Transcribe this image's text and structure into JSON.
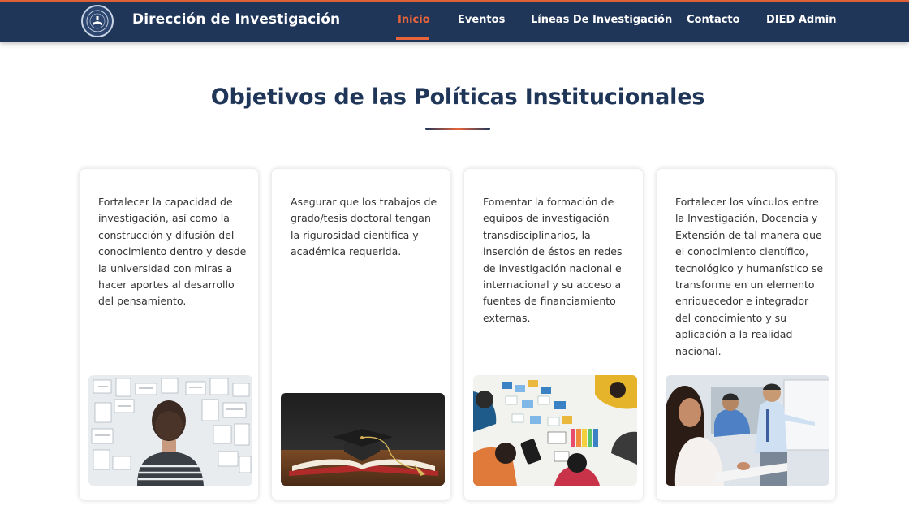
{
  "header": {
    "logo_icon": "university-seal-icon",
    "brand": "Dirección de Investigación",
    "nav": [
      {
        "label": "Inicio",
        "active": true
      },
      {
        "label": "Eventos",
        "active": false
      },
      {
        "label": "Líneas De Investigación",
        "active": false
      },
      {
        "label": "Contacto",
        "active": false
      },
      {
        "label": "DIED Admin",
        "active": false
      }
    ]
  },
  "main": {
    "title": "Objetivos de las Políticas Institucionales",
    "cards": [
      {
        "text": "Fortalecer la capacidad de investigación, así como la construcción y difusión del conocimiento dentro y desde la universidad con miras a hacer aportes al desarrollo del pensamiento.",
        "image": "student-at-research-board-photo"
      },
      {
        "text": "Asegurar que los trabajos de grado/tesis doctoral tengan la rigurosidad científica y académica requerida.",
        "image": "graduation-cap-on-book-photo"
      },
      {
        "text": "Fomentar la formación de equipos de investigación transdisciplinarios, la inserción de éstos en redes de investigación nacional e internacional y su acceso a fuentes de financiamiento externas.",
        "image": "team-planning-table-photo"
      },
      {
        "text": "Fortalecer los vínculos entre la Investigación, Docencia y Extensión de tal manera que el conocimiento científico, tecnológico y humanístico se transforme en un elemento enriquecedor e integrador del conocimiento y su aplicación a la realidad nacional.",
        "image": "classroom-teacher-photo"
      }
    ]
  },
  "colors": {
    "navy": "#1f3659",
    "accent": "#e8643a",
    "background": "#ffffff"
  }
}
